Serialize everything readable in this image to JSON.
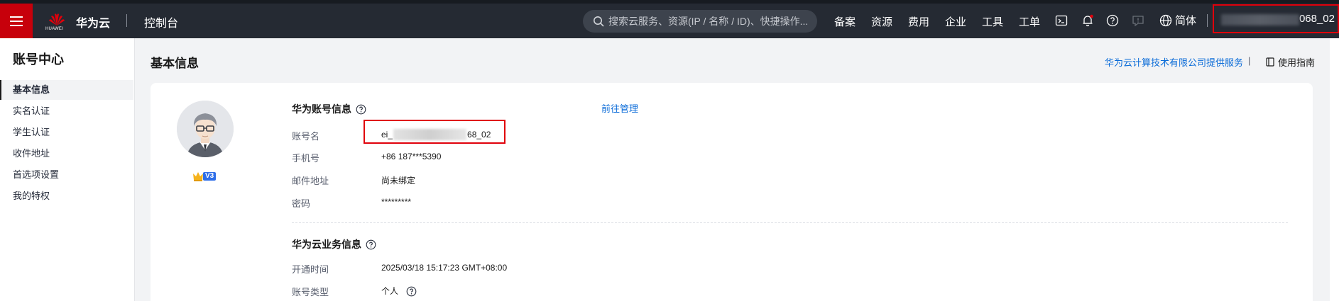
{
  "topbar": {
    "logo_text": "HUAWEI",
    "brand": "华为云",
    "console": "控制台",
    "search_placeholder": "搜索云服务、资源(IP / 名称 / ID)、快捷操作...",
    "nav": [
      "备案",
      "资源",
      "费用",
      "企业",
      "工具",
      "工单"
    ],
    "icons": [
      "terminal-icon",
      "bell-icon",
      "help-icon",
      "feedback-icon"
    ],
    "language": "简体",
    "user_suffix": "068_02",
    "accent": "#c7000b"
  },
  "sidebar": {
    "title": "账号中心",
    "items": [
      {
        "label": "基本信息",
        "active": true
      },
      {
        "label": "实名认证",
        "active": false
      },
      {
        "label": "学生认证",
        "active": false
      },
      {
        "label": "收件地址",
        "active": false
      },
      {
        "label": "首选项设置",
        "active": false
      },
      {
        "label": "我的特权",
        "active": false
      }
    ]
  },
  "main": {
    "title": "基本信息",
    "provider_link": "华为云计算技术有限公司提供服务",
    "guide": "使用指南",
    "badge_level": "V3",
    "account_section": {
      "title": "华为账号信息",
      "manage_link": "前往管理",
      "fields": [
        {
          "label": "账号名",
          "value_prefix": "ei_",
          "value_suffix": "68_02"
        },
        {
          "label": "手机号",
          "value": "+86 187***5390"
        },
        {
          "label": "邮件地址",
          "value": "尚未绑定"
        },
        {
          "label": "密码",
          "value": "*********"
        }
      ]
    },
    "business_section": {
      "title": "华为云业务信息",
      "fields": [
        {
          "label": "开通时间",
          "value": "2025/03/18 15:17:23 GMT+08:00"
        },
        {
          "label": "账号类型",
          "value": "个人"
        }
      ]
    }
  }
}
